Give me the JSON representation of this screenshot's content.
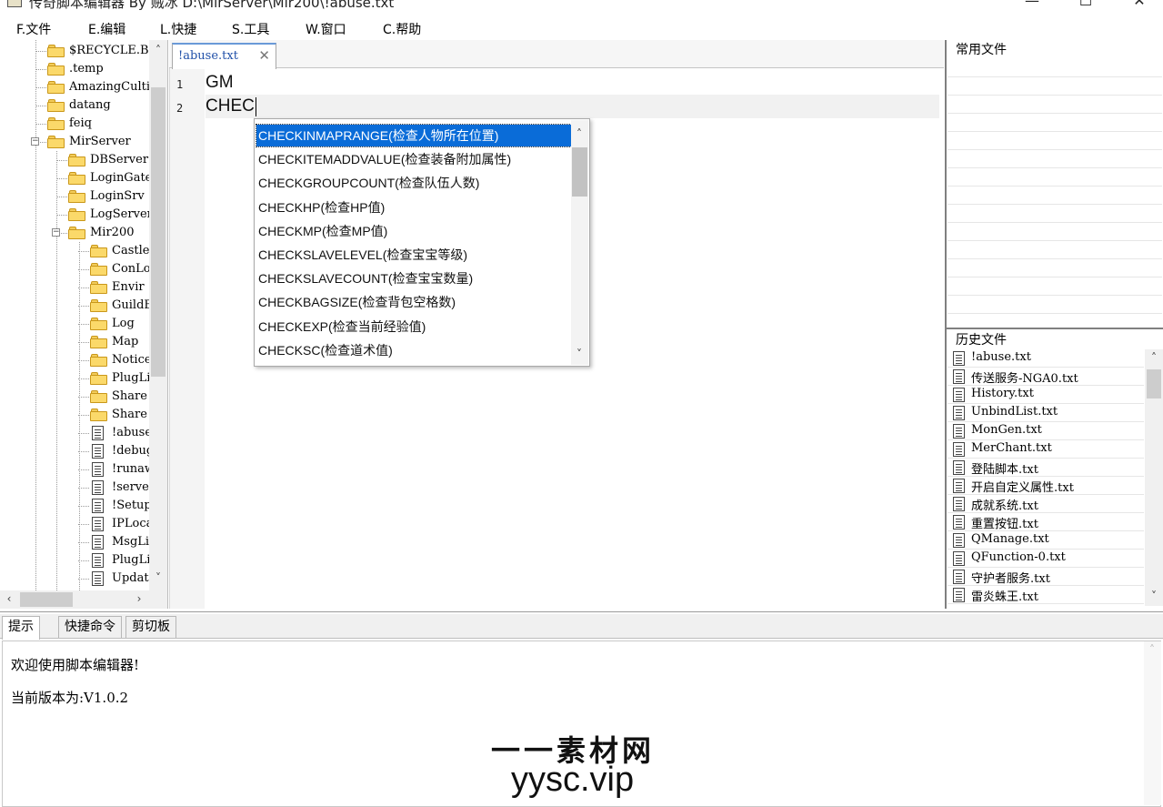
{
  "window": {
    "title": "传奇脚本编辑器 By 贼冰  D:\\MirServer\\Mir200\\!abuse.txt",
    "min_glyph": "—",
    "max_glyph": "☐",
    "close_glyph": "✕"
  },
  "menu": [
    "F.文件",
    "E.编辑",
    "L.快捷",
    "S.工具",
    "W.窗口",
    "C.帮助"
  ],
  "tree": {
    "items": [
      {
        "label": "$RECYCLE.BIN",
        "type": "folder"
      },
      {
        "label": ".temp",
        "type": "folder"
      },
      {
        "label": "AmazingCultivation",
        "type": "folder"
      },
      {
        "label": "datang",
        "type": "folder"
      },
      {
        "label": "feiq",
        "type": "folder"
      },
      {
        "label": "MirServer",
        "type": "folder",
        "expanded": true
      },
      {
        "label": "DBServer",
        "type": "folder"
      },
      {
        "label": "LoginGate",
        "type": "folder"
      },
      {
        "label": "LoginSrv",
        "type": "folder"
      },
      {
        "label": "LogServer",
        "type": "folder"
      },
      {
        "label": "Mir200",
        "type": "folder",
        "expanded": true
      },
      {
        "label": "Castle",
        "type": "folder"
      },
      {
        "label": "ConLog",
        "type": "folder"
      },
      {
        "label": "Envir",
        "type": "folder"
      },
      {
        "label": "GuildBase",
        "type": "folder"
      },
      {
        "label": "Log",
        "type": "folder"
      },
      {
        "label": "Map",
        "type": "folder"
      },
      {
        "label": "Notice",
        "type": "folder"
      },
      {
        "label": "PlugList",
        "type": "folder"
      },
      {
        "label": "Share",
        "type": "folder"
      },
      {
        "label": "Share",
        "type": "folder"
      },
      {
        "label": "!abuse.txt",
        "type": "file"
      },
      {
        "label": "!debug.txt",
        "type": "file"
      },
      {
        "label": "!runaway.txt",
        "type": "file"
      },
      {
        "label": "!server.txt",
        "type": "file"
      },
      {
        "label": "!Setup.txt",
        "type": "file"
      },
      {
        "label": "IPLocal.txt",
        "type": "file"
      },
      {
        "label": "MsgList.txt",
        "type": "file"
      },
      {
        "label": "PlugList.txt",
        "type": "file"
      },
      {
        "label": "Update.txt",
        "type": "file"
      }
    ]
  },
  "editor": {
    "tab_label": "!abuse.txt",
    "tab_close": "✕",
    "line_numbers": [
      "1",
      "2"
    ],
    "lines": [
      "GM",
      "CHEC"
    ]
  },
  "autocomplete": {
    "selected_index": 0,
    "items": [
      "CHECKINMAPRANGE(检查人物所在位置)",
      "CHECKITEMADDVALUE(检查装备附加属性)",
      "CHECKGROUPCOUNT(检查队伍人数)",
      "CHECKHP(检查HP值)",
      "CHECKMP(检查MP值)",
      "CHECKSLAVELEVEL(检查宝宝等级)",
      "CHECKSLAVECOUNT(检查宝宝数量)",
      "CHECKBAGSIZE(检查背包空格数)",
      "CHECKEXP(检查当前经验值)",
      "CHECKSC(检查道术值)"
    ]
  },
  "right_panel": {
    "common_title": "常用文件",
    "history_title": "历史文件",
    "history": [
      "!abuse.txt",
      "传送服务-NGA0.txt",
      "History.txt",
      "UnbindList.txt",
      "MonGen.txt",
      "MerChant.txt",
      "登陆脚本.txt",
      "开启自定义属性.txt",
      "成就系统.txt",
      "重置按钮.txt",
      "QManage.txt",
      "QFunction-0.txt",
      "守护者服务.txt",
      "雷炎蛛王.txt"
    ]
  },
  "bottom": {
    "tabs": [
      "提示",
      "快捷命令",
      "剪切板"
    ],
    "active_tab": 0,
    "messages": [
      "欢迎使用脚本编辑器!",
      "当前版本为:V1.0.2"
    ]
  },
  "watermark": {
    "line1": "一一素材网",
    "line2": "yysc.vip"
  },
  "colors": {
    "selection": "#0a6cd8",
    "folder": "#fbd96a",
    "tab_accent": "#6a9ad8"
  }
}
